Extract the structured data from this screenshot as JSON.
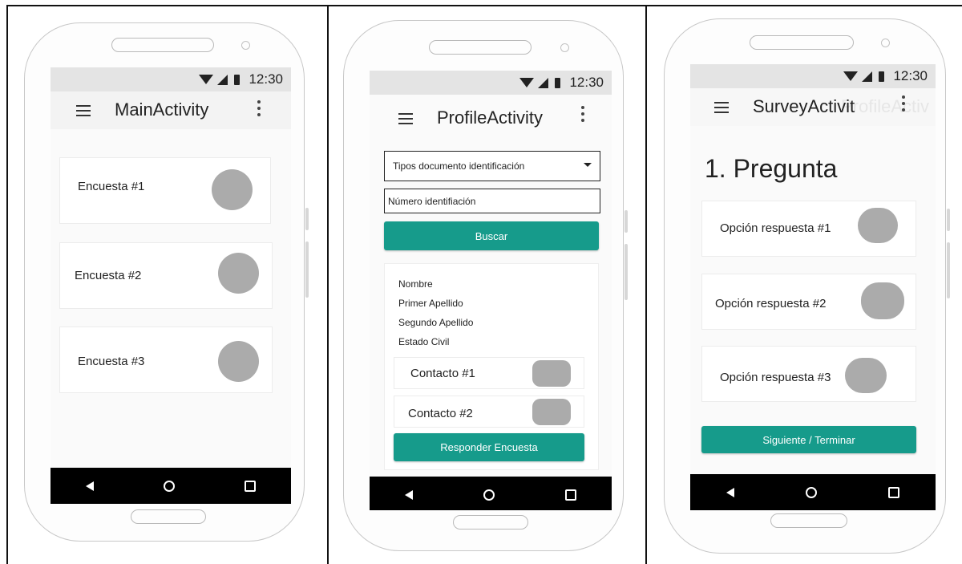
{
  "status": {
    "time": "12:30"
  },
  "main": {
    "title": "MainActivity",
    "items": [
      {
        "label": "Encuesta #1"
      },
      {
        "label": "Encuesta #2"
      },
      {
        "label": "Encuesta #3"
      }
    ]
  },
  "profile": {
    "title": "ProfileActivity",
    "select_value": "Tipos documento identificación",
    "id_placeholder": "Número identifiación",
    "search_label": "Buscar",
    "fields": [
      "Nombre",
      "Primer Apellido",
      "Segundo Apellido",
      "Estado Civil"
    ],
    "contacts": [
      {
        "label": "Contacto #1"
      },
      {
        "label": "Contacto #2"
      }
    ],
    "answer_label": "Responder Encuesta"
  },
  "survey": {
    "title": "SurveyActivit",
    "question": "1. Pregunta",
    "options": [
      {
        "label": "Opción respuesta #1"
      },
      {
        "label": "Opción respuesta #2"
      },
      {
        "label": "Opción respuesta #3"
      }
    ],
    "next_label": "Siguiente / Terminar",
    "ghost_title": "ProfileActiv"
  },
  "colors": {
    "accent": "#169b8b",
    "placeholder": "#ababab"
  },
  "icons": [
    "wifi-icon",
    "signal-icon",
    "battery-icon",
    "menu-icon",
    "more-vert-icon",
    "back-icon",
    "home-icon",
    "recents-icon"
  ]
}
